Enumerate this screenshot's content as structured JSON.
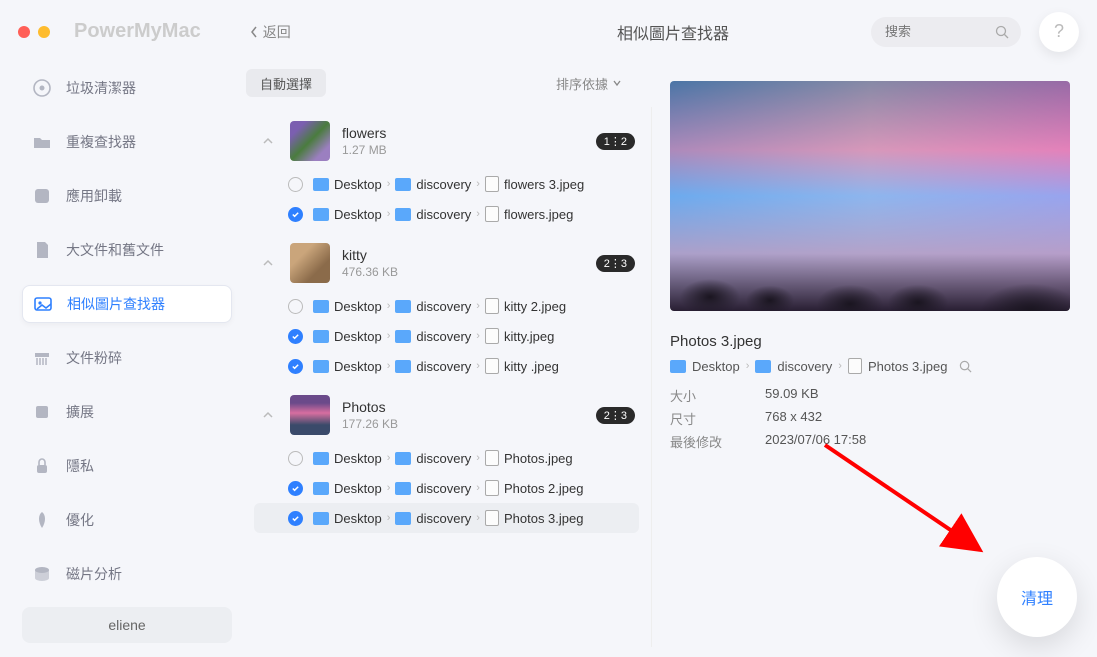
{
  "app": {
    "title": "PowerMyMac",
    "back": "返回",
    "page_title": "相似圖片查找器"
  },
  "search": {
    "placeholder": "搜索"
  },
  "help": {
    "label": "?"
  },
  "sidebar": {
    "items": [
      {
        "label": "垃圾清潔器"
      },
      {
        "label": "重複查找器"
      },
      {
        "label": "應用卸載"
      },
      {
        "label": "大文件和舊文件"
      },
      {
        "label": "相似圖片查找器"
      },
      {
        "label": "文件粉碎"
      },
      {
        "label": "擴展"
      },
      {
        "label": "隱私"
      },
      {
        "label": "優化"
      },
      {
        "label": "磁片分析"
      }
    ],
    "user": "eliene"
  },
  "toolbar": {
    "auto_select": "自動選擇",
    "sort": "排序依據"
  },
  "path": {
    "desktop": "Desktop",
    "discovery": "discovery"
  },
  "groups": [
    {
      "name": "flowers",
      "size": "1.27 MB",
      "badge": "1⋮2",
      "files": [
        {
          "checked": false,
          "name": "flowers 3.jpeg"
        },
        {
          "checked": true,
          "name": "flowers.jpeg"
        }
      ]
    },
    {
      "name": "kitty",
      "size": "476.36 KB",
      "badge": "2⋮3",
      "files": [
        {
          "checked": false,
          "name": "kitty 2.jpeg"
        },
        {
          "checked": true,
          "name": "kitty.jpeg"
        },
        {
          "checked": true,
          "name": "kitty .jpeg"
        }
      ]
    },
    {
      "name": "Photos",
      "size": "177.26 KB",
      "badge": "2⋮3",
      "files": [
        {
          "checked": false,
          "name": "Photos.jpeg"
        },
        {
          "checked": true,
          "name": "Photos 2.jpeg"
        },
        {
          "checked": true,
          "name": "Photos 3.jpeg",
          "selected": true
        }
      ]
    }
  ],
  "preview": {
    "filename": "Photos 3.jpeg",
    "path_file": "Photos 3.jpeg",
    "labels": {
      "size": "大小",
      "dim": "尺寸",
      "mod": "最後修改"
    },
    "size": "59.09 KB",
    "dim": "768 x 432",
    "mod": "2023/07/06 17:58"
  },
  "clean": {
    "label": "清理"
  }
}
